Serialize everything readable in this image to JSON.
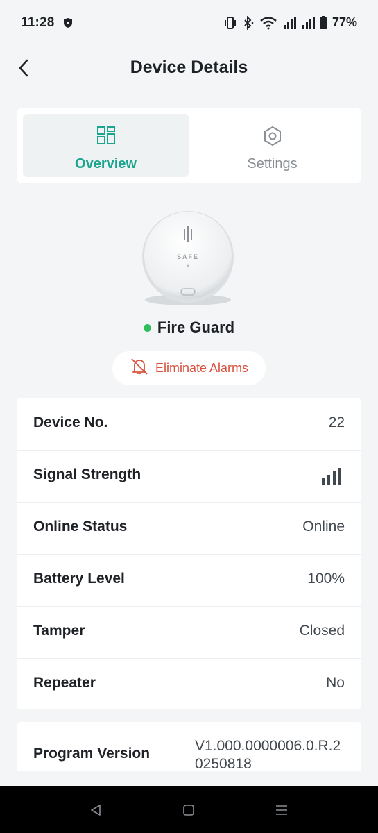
{
  "status_bar": {
    "time": "11:28",
    "battery_percent": "77%"
  },
  "header": {
    "title": "Device Details"
  },
  "tabs": [
    {
      "label": "Overview",
      "icon": "grid-icon",
      "active": true
    },
    {
      "label": "Settings",
      "icon": "hexagon-gear-icon",
      "active": false
    }
  ],
  "device": {
    "image_brand_text": "SAFE",
    "name": "Fire Guard",
    "status_color": "#2fbf5a"
  },
  "actions": {
    "eliminate_alarms": "Eliminate Alarms"
  },
  "info_rows": [
    {
      "label": "Device No.",
      "value": "22"
    },
    {
      "label": "Signal Strength",
      "value": "signal-bars-icon",
      "signal_level": 4
    },
    {
      "label": "Online Status",
      "value": "Online"
    },
    {
      "label": "Battery Level",
      "value": "100%"
    },
    {
      "label": "Tamper",
      "value": "Closed"
    },
    {
      "label": "Repeater",
      "value": "No"
    }
  ],
  "program": {
    "label": "Program Version",
    "value": "V1.000.0000006.0.R.20250818"
  },
  "colors": {
    "accent": "#19a58e",
    "alert": "#d9523f",
    "online": "#2fbf5a"
  }
}
